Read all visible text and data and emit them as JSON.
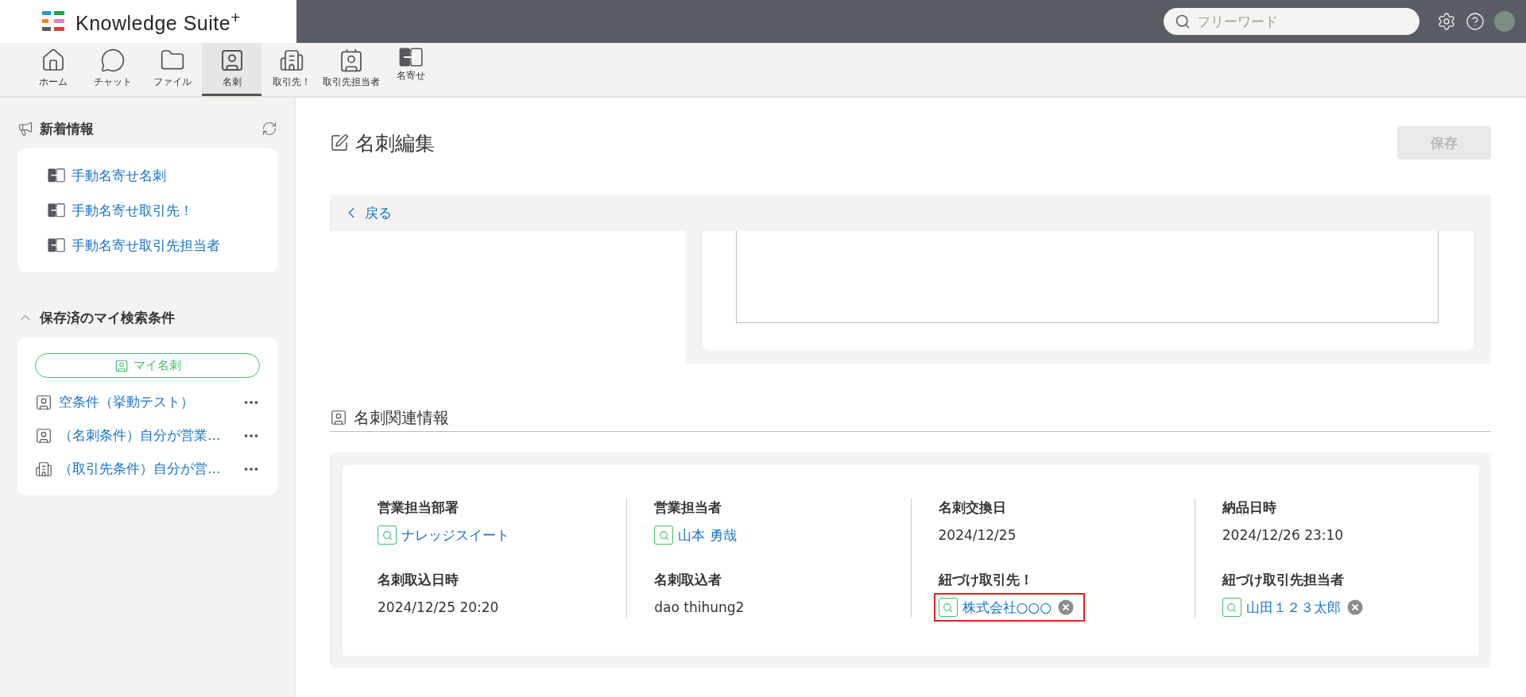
{
  "header": {
    "logo": "Knowledge Suite$^{+}$",
    "search": {
      "placeholder": "フリーワード"
    }
  },
  "nav": [
    {
      "label": "ホーム",
      "selected": false
    },
    {
      "label": "チャット",
      "selected": false
    },
    {
      "label": "ファイル",
      "selected": false
    },
    {
      "label": "名刺",
      "selected": true
    },
    {
      "label": "取引先！",
      "selected": false
    },
    {
      "label": "取引先担当者",
      "selected": false
    },
    {
      "label": "名寄せ",
      "selected": false
    }
  ],
  "sidebar": {
    "news": {
      "title": "新着情報",
      "items": [
        "手動名寄せ名刺",
        "手動名寄せ取引先！",
        "手動名寄せ取引先担当者"
      ]
    },
    "saved": {
      "title": "保存済のマイ検索条件",
      "expanded": true,
      "pill": "マイ名刺",
      "items": [
        {
          "label": "空条件（挙動テスト）",
          "kind": "card"
        },
        {
          "label": "（名刺条件）自分が営業…",
          "kind": "card"
        },
        {
          "label": "（取引先条件）自分が営…",
          "kind": "company"
        }
      ]
    }
  },
  "main": {
    "title": "名刺編集",
    "save_button": {
      "label": "保存",
      "disabled": true
    },
    "back": "戻る",
    "section": {
      "title": "名刺関連情報",
      "columns": [
        [
          {
            "label": "営業担当部署",
            "kind": "link",
            "value": "ナレッジスイート",
            "removable": false,
            "highlighted": false
          },
          {
            "label": "名刺取込日時",
            "kind": "text",
            "value": "2024/12/25 20:20"
          }
        ],
        [
          {
            "label": "営業担当者",
            "kind": "link",
            "value": "山本 勇哉",
            "removable": false,
            "highlighted": false
          },
          {
            "label": "名刺取込者",
            "kind": "text",
            "value": "dao thihung2"
          }
        ],
        [
          {
            "label": "名刺交換日",
            "kind": "text",
            "value": "2024/12/25"
          },
          {
            "label": "紐づけ取引先！",
            "kind": "link",
            "value": "株式会社○○○",
            "removable": true,
            "highlighted": true
          }
        ],
        [
          {
            "label": "納品日時",
            "kind": "text",
            "value": "2024/12/26 23:10"
          },
          {
            "label": "紐づけ取引先担当者",
            "kind": "link",
            "value": "山田１２３太郎",
            "removable": true,
            "highlighted": false
          }
        ]
      ]
    }
  }
}
